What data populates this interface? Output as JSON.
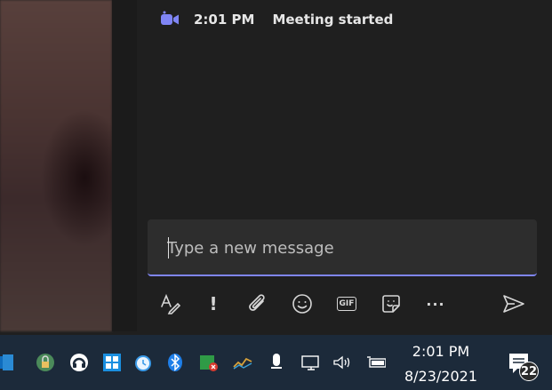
{
  "meeting": {
    "icon": "video-camera-icon",
    "time": "2:01 PM",
    "text": "Meeting started"
  },
  "compose": {
    "placeholder": "Type a new message",
    "accent": "#7f85f5"
  },
  "toolbar": {
    "items": [
      {
        "icon": "format-icon"
      },
      {
        "icon": "important-icon",
        "label": "!"
      },
      {
        "icon": "attach-icon"
      },
      {
        "icon": "emoji-icon"
      },
      {
        "icon": "gif-icon",
        "label": "GIF"
      },
      {
        "icon": "sticker-icon"
      },
      {
        "icon": "more-icon",
        "label": "···"
      },
      {
        "icon": "send-icon"
      }
    ]
  },
  "taskbar": {
    "clock_time": "2:01 PM",
    "clock_date": "8/23/2021",
    "notification_count": "22",
    "icons": [
      "outlook-icon",
      "lock-app-icon",
      "headset-app-icon",
      "windows-app-icon",
      "alarm-app-icon",
      "bluetooth-icon",
      "network-app-icon",
      "graph-app-icon",
      "microphone-icon",
      "display-icon",
      "volume-icon",
      "battery-icon"
    ]
  }
}
